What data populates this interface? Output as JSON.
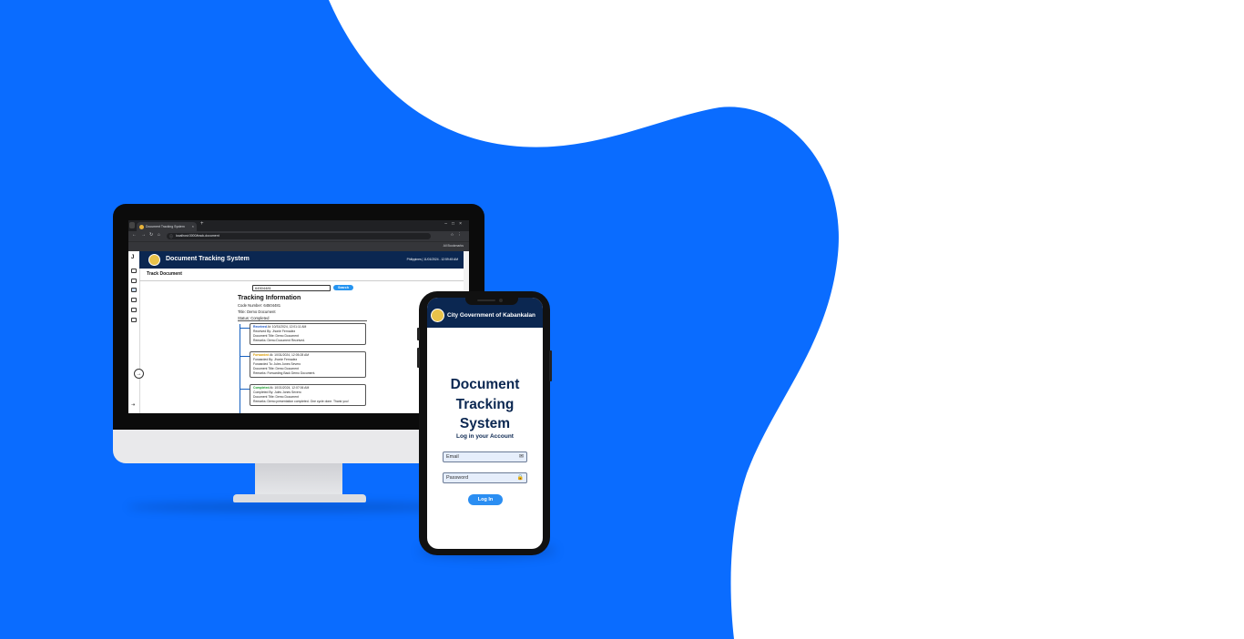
{
  "colors": {
    "brand_blue": "#0a6cff",
    "header_navy": "#0b2751",
    "search_blue": "#2694f0"
  },
  "browser": {
    "tab_title": "Document Tracking System",
    "url": "localhost:3000/track-document",
    "bookmarks": "All Bookmarks"
  },
  "desktop_app": {
    "title": "Document Tracking System",
    "header_date": "Philippines | 11/01/2024 - 12:59:45 AM",
    "page_title": "Track Document",
    "search_value": "64504481",
    "search_button": "Search",
    "tracking_title": "Tracking Information",
    "code_number": "Code Number: 64504481",
    "doc_title": "Title: Demo Document",
    "status": "Status: Completed",
    "cards": [
      {
        "status": "Received",
        "status_rest": " At: 10/31/2024, 12:01:11 AM",
        "lines": [
          "Received By: Jhonie Fernadez",
          "Document Title: Demo Document",
          "Remarks: Demo Document Received."
        ]
      },
      {
        "status": "Forwarded",
        "status_rest": " At: 10/31/2024, 12:05:28 AM",
        "lines": [
          "Forwarded By: Jhonie Fernadez",
          "Forwarded To: Jules Jones Severo",
          "Document Title: Demo Document",
          "Remarks: Forwarding Back Demo Document."
        ]
      },
      {
        "status": "Completed",
        "status_rest": " At: 10/31/2024, 12:07:06 AM",
        "lines": [
          "Completed By: Jules Jones Severo",
          "Document Title: Demo Document",
          "Remarks: Demo presentation completed. One cycle done. Thank you!"
        ]
      }
    ]
  },
  "mobile_app": {
    "header_title": "City Government of Kabankalan",
    "heading_lines": [
      "Document",
      "Tracking",
      "System"
    ],
    "subtitle": "Log in your Account",
    "email_placeholder": "Email",
    "password_placeholder": "Password",
    "login_button": "Log In"
  }
}
